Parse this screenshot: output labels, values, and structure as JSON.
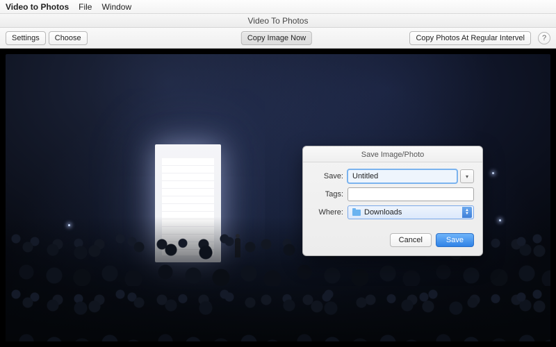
{
  "menubar": {
    "appName": "Video to Photos",
    "items": [
      "File",
      "Window"
    ]
  },
  "window": {
    "title": "Video To Photos"
  },
  "toolbar": {
    "settings": "Settings",
    "choose": "Choose",
    "copyNow": "Copy Image Now",
    "copyInterval": "Copy Photos At Regular Intervel",
    "help": "?"
  },
  "saveSheet": {
    "title": "Save Image/Photo",
    "saveLabel": "Save:",
    "saveValue": "Untitled",
    "tagsLabel": "Tags:",
    "tagsValue": "",
    "whereLabel": "Where:",
    "whereValue": "Downloads",
    "cancel": "Cancel",
    "confirm": "Save"
  }
}
